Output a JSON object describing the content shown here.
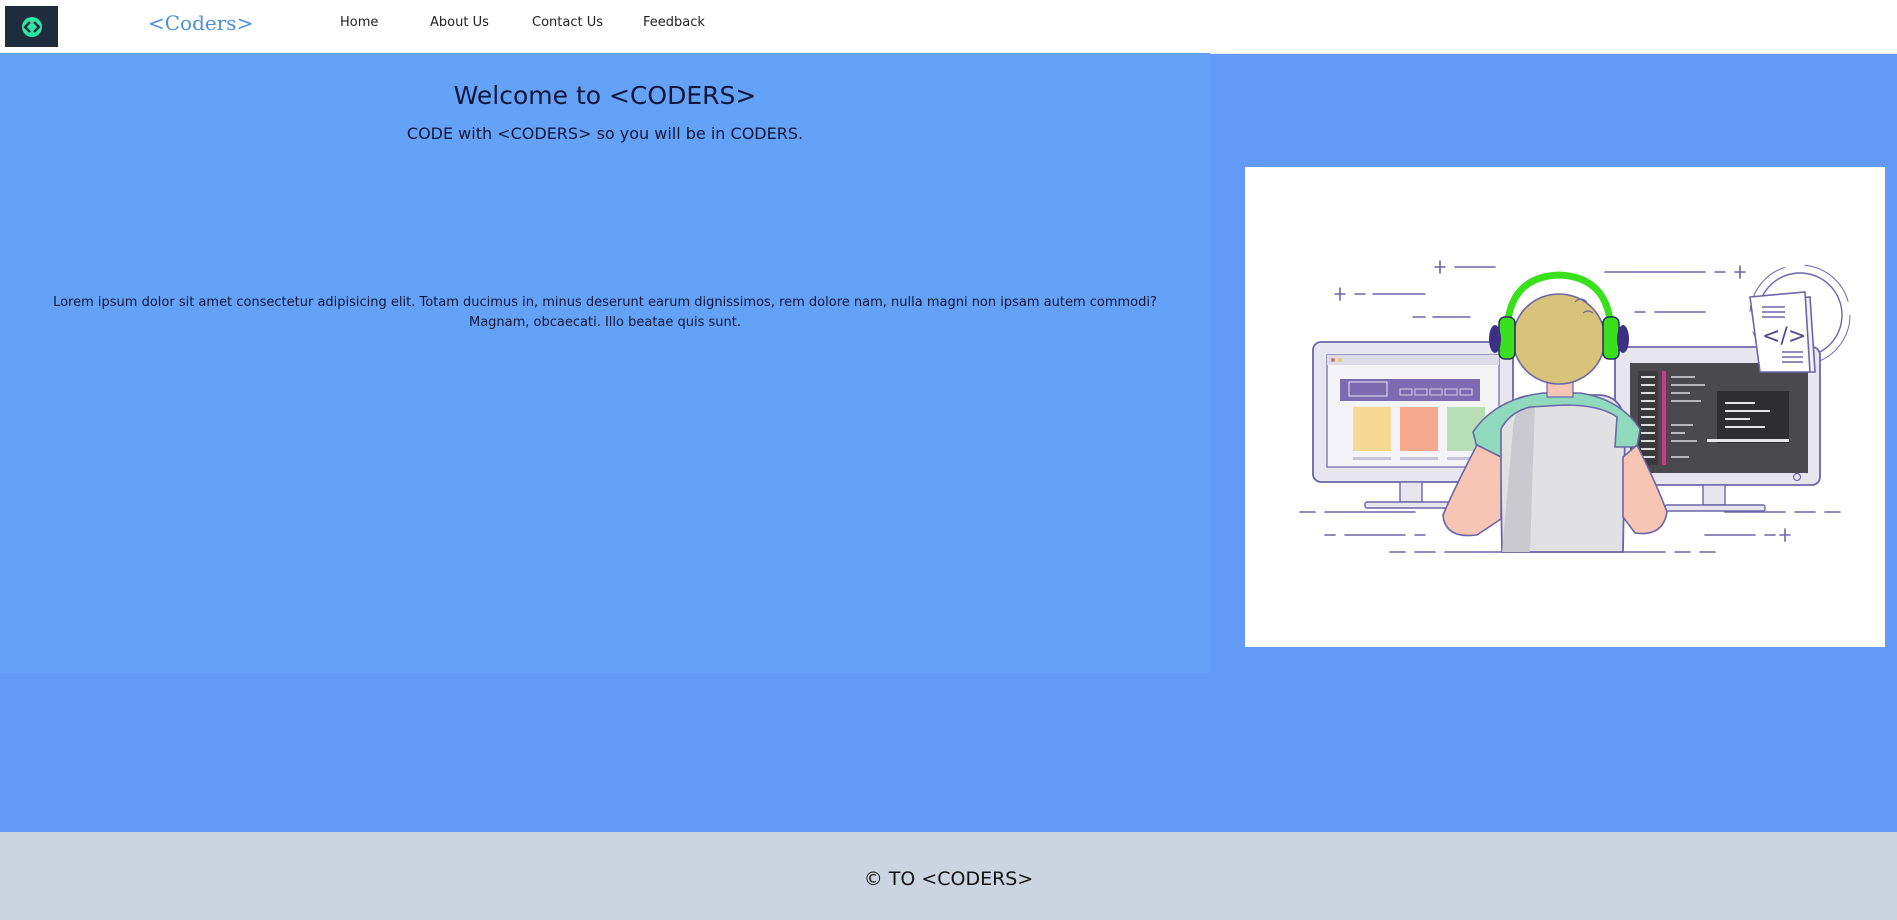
{
  "header": {
    "logo_icon": "code-brackets-icon",
    "logo_color": "#1f2d3d",
    "logo_accent": "#2ee6a6",
    "brand": "<Coders>",
    "nav": [
      {
        "label": "Home"
      },
      {
        "label": "About Us"
      },
      {
        "label": "Contact Us"
      },
      {
        "label": "Feedback"
      }
    ]
  },
  "hero": {
    "title": "Welcome to <CODERS>",
    "subtitle": "CODE with <CODERS> so you will be in CODERS.",
    "body": "Lorem ipsum dolor sit amet consectetur adipisicing elit. Totam ducimus in, minus deserunt earum dignissimos, rem dolore nam, nulla magni non ipsam autem commodi? Magnam, obcaecati. Illo beatae quis sunt.",
    "illustration": {
      "icon": "coder-at-desk-illustration",
      "code_tag": "</>"
    }
  },
  "colors": {
    "page_bg": "#639af5",
    "hero_bg": "#64a2f8",
    "footer_bg": "#cbd5e1",
    "headphones": "#39e01c"
  },
  "footer": {
    "text": "© TO <CODERS>"
  }
}
